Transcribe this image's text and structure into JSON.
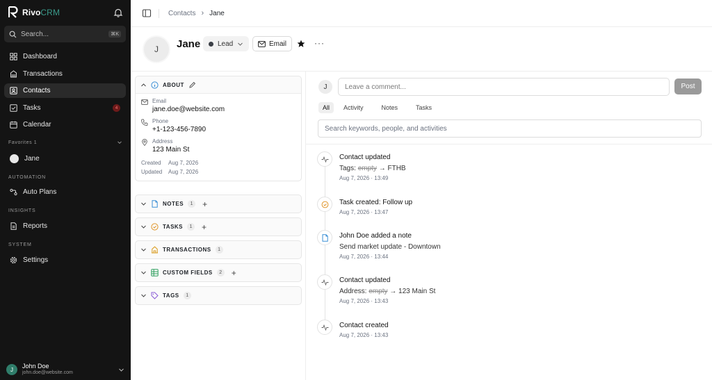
{
  "app": {
    "name": "Rivo",
    "name_suffix": "CRM"
  },
  "sidebar": {
    "search": {
      "placeholder": "Search...",
      "shortcut": "⌘K"
    },
    "nav": [
      {
        "label": "Dashboard",
        "icon": "grid-icon"
      },
      {
        "label": "Transactions",
        "icon": "building-icon"
      },
      {
        "label": "Contacts",
        "icon": "contact-card-icon"
      },
      {
        "label": "Tasks",
        "icon": "checkbox-icon",
        "badge": "4"
      },
      {
        "label": "Calendar",
        "icon": "calendar-icon"
      }
    ],
    "favorites": {
      "label": "Favorites",
      "count": "1",
      "items": [
        {
          "label": "Jane"
        }
      ]
    },
    "automation": {
      "label": "AUTOMATION",
      "items": [
        {
          "label": "Auto Plans",
          "icon": "flow-icon"
        }
      ]
    },
    "insights": {
      "label": "INSIGHTS",
      "items": [
        {
          "label": "Reports",
          "icon": "report-icon"
        }
      ]
    },
    "system": {
      "label": "SYSTEM",
      "items": [
        {
          "label": "Settings",
          "icon": "gear-icon"
        }
      ]
    },
    "user": {
      "initial": "J",
      "name": "John Doe",
      "email": "john.doe@website.com"
    }
  },
  "breadcrumb": {
    "parent": "Contacts",
    "separator": "›",
    "current": "Jane"
  },
  "contact": {
    "initial": "J",
    "name": "Jane",
    "status": "Lead",
    "email_button": "Email",
    "more": "···"
  },
  "about": {
    "title": "ABOUT",
    "email_label": "Email",
    "email": "jane.doe@website.com",
    "phone_label": "Phone",
    "phone": "+1-123-456-7890",
    "address_label": "Address",
    "address": "123 Main St",
    "created_label": "Created",
    "created": "Aug 7, 2026",
    "updated_label": "Updated",
    "updated": "Aug 7, 2026"
  },
  "sections": [
    {
      "title": "NOTES",
      "count": "1",
      "add": "+"
    },
    {
      "title": "TASKS",
      "count": "1",
      "add": "+"
    },
    {
      "title": "TRANSACTIONS",
      "count": "1"
    },
    {
      "title": "CUSTOM FIELDS",
      "count": "2",
      "add": "+"
    },
    {
      "title": "TAGS",
      "count": "1"
    }
  ],
  "comment": {
    "initial": "J",
    "placeholder": "Leave a comment...",
    "post_label": "Post"
  },
  "tabs": [
    "All",
    "Activity",
    "Notes",
    "Tasks"
  ],
  "activity_search": {
    "placeholder": "Search keywords, people, and activities"
  },
  "colors": {
    "accent_teal": "#2f7d6a",
    "badge_red": "#ff7a7a",
    "task_orange": "#e0952a",
    "note_blue": "#3a8fd6"
  },
  "timeline": [
    {
      "icon": "activity-pulse-icon",
      "title": "Contact updated",
      "detail_prefix": "Tags:",
      "old": "empty",
      "arrow": "→",
      "new": "FTHB",
      "time": "Aug 7, 2026 · 13:49"
    },
    {
      "icon": "task-clock-icon",
      "title_prefix": "Task created:",
      "title_emph": "Follow up",
      "time": "Aug 7, 2026 · 13:47"
    },
    {
      "icon": "note-icon",
      "title": "John Doe added a note",
      "detail": "Send market update - Downtown",
      "time": "Aug 7, 2026 · 13:44"
    },
    {
      "icon": "activity-pulse-icon",
      "title": "Contact updated",
      "detail_prefix": "Address:",
      "old": "empty",
      "arrow": "→",
      "new": "123 Main St",
      "time": "Aug 7, 2026 · 13:43"
    },
    {
      "icon": "activity-pulse-icon",
      "title": "Contact created",
      "time": "Aug 7, 2026 · 13:43"
    }
  ]
}
